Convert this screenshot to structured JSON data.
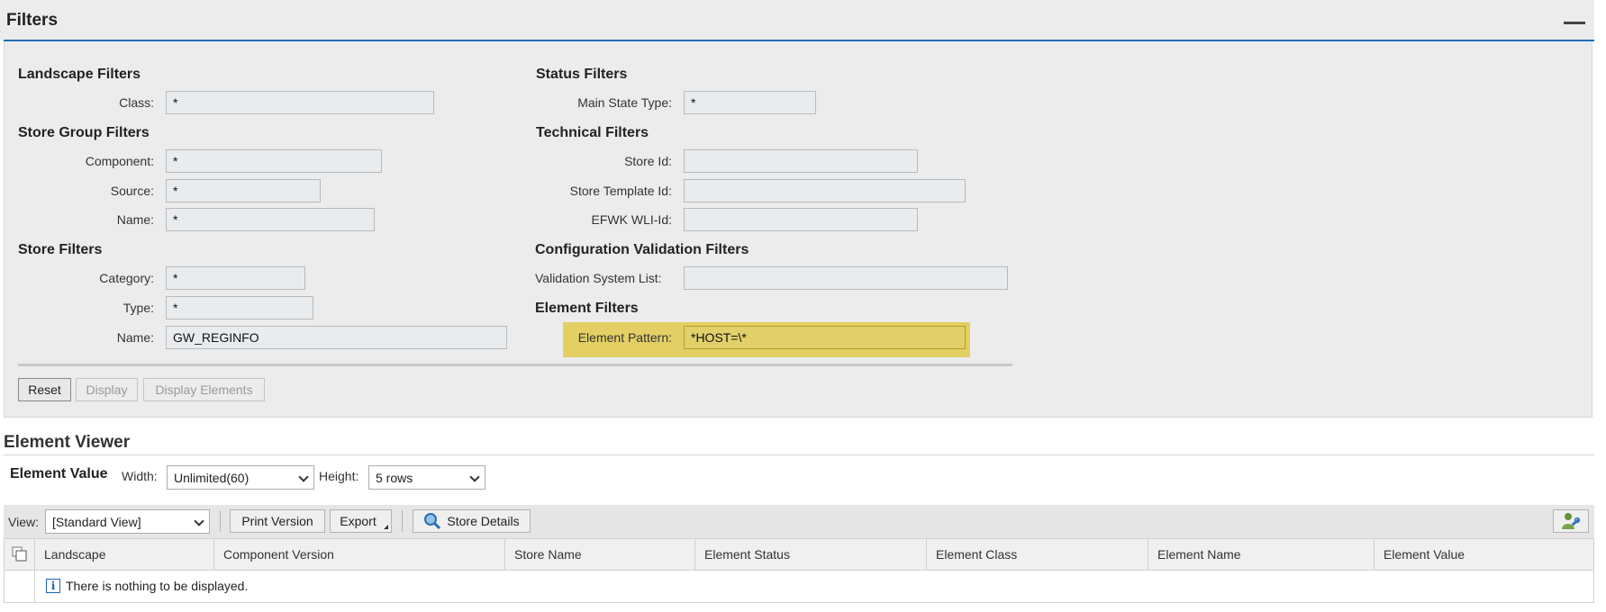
{
  "panel": {
    "title": "Filters"
  },
  "landscape": {
    "title": "Landscape Filters",
    "class_label": "Class:",
    "class_value": "*"
  },
  "store_group": {
    "title": "Store Group Filters",
    "component_label": "Component:",
    "component_value": "*",
    "source_label": "Source:",
    "source_value": "*",
    "name_label": "Name:",
    "name_value": "*"
  },
  "store": {
    "title": "Store Filters",
    "category_label": "Category:",
    "category_value": "*",
    "type_label": "Type:",
    "type_value": "*",
    "name_label": "Name:",
    "name_value": "GW_REGINFO"
  },
  "status": {
    "title": "Status Filters",
    "main_state_label": "Main State Type:",
    "main_state_value": "*"
  },
  "technical": {
    "title": "Technical Filters",
    "store_id_label": "Store Id:",
    "store_id_value": "",
    "template_label": "Store Template Id:",
    "template_value": "",
    "efwk_label": "EFWK WLI-Id:",
    "efwk_value": ""
  },
  "config": {
    "title": "Configuration Validation Filters",
    "system_list_label": "Validation System List:",
    "system_list_value": ""
  },
  "element": {
    "title": "Element Filters",
    "pattern_label": "Element Pattern:",
    "pattern_value": "*HOST=\\*"
  },
  "actions": {
    "reset": "Reset",
    "display": "Display",
    "display_elements": "Display Elements"
  },
  "viewer": {
    "title": "Element Viewer",
    "value_label": "Element Value",
    "width_label": "Width:",
    "width_value": "Unlimited(60)",
    "height_label": "Height:",
    "height_value": "5 rows"
  },
  "toolbar": {
    "view_label": "View:",
    "view_value": "[Standard View]",
    "print": "Print Version",
    "export": "Export",
    "store_details": "Store Details"
  },
  "table": {
    "columns": [
      "Landscape",
      "Component Version",
      "Store Name",
      "Element Status",
      "Element Class",
      "Element Name",
      "Element Value"
    ],
    "empty_message": "There is nothing to be displayed."
  },
  "colors": {
    "accent": "#1f6fb5",
    "highlight": "#e3cf63"
  }
}
